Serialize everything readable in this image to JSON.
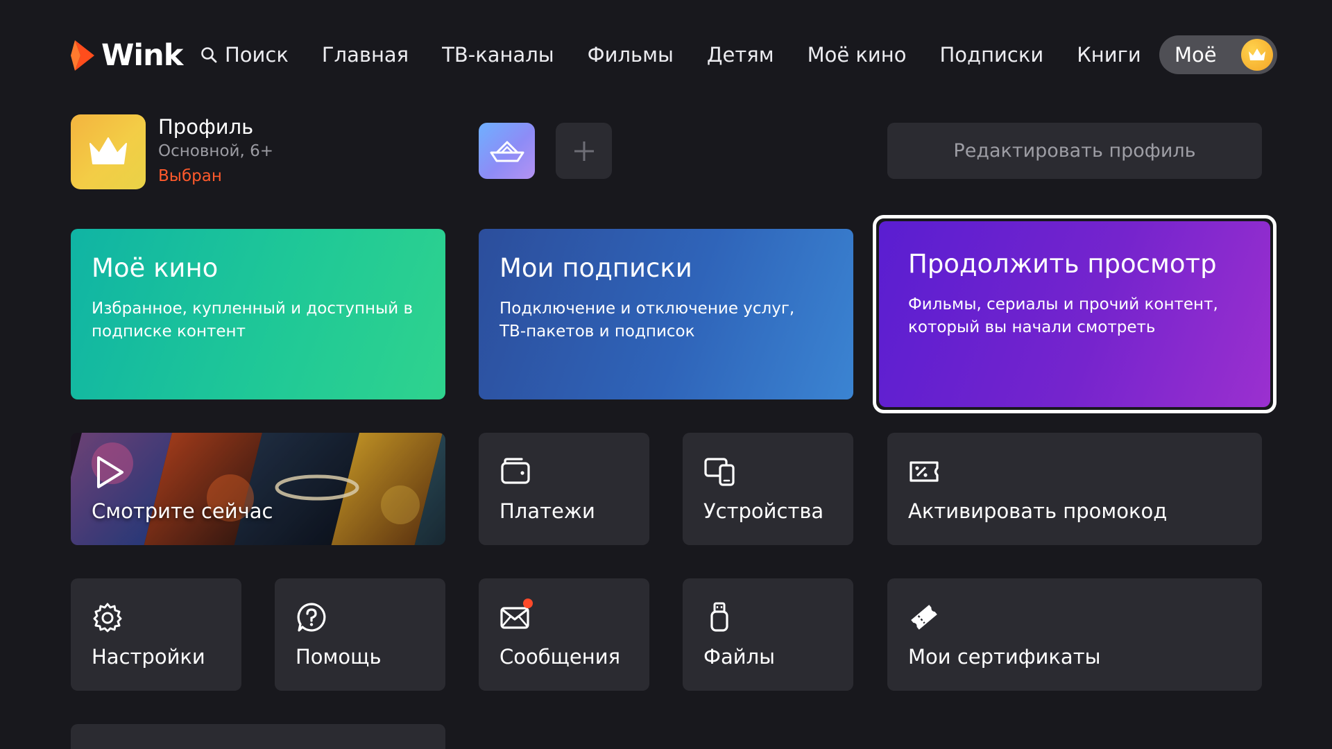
{
  "app": {
    "brand": "Wink",
    "accent_color": "#ff4d1c"
  },
  "nav": {
    "search": "Поиск",
    "items": [
      "Главная",
      "ТВ-каналы",
      "Фильмы",
      "Детям",
      "Моё кино",
      "Подписки",
      "Книги"
    ],
    "my": "Моё",
    "my_icon": "crown-icon"
  },
  "profile": {
    "name": "Профиль",
    "subtitle": "Основной, 6+",
    "status": "Выбран",
    "status_color": "#ff5a2c",
    "avatar_icon": "crown-icon",
    "alt_avatar_icon": "boat-icon",
    "add_icon": "plus-icon",
    "edit_label": "Редактировать профиль"
  },
  "features": [
    {
      "title": "Моё кино",
      "description": "Избранное, купленный и доступный в подписке контент"
    },
    {
      "title": "Мои подписки",
      "description": "Подключение и отключение услуг, ТВ-пакетов и подписок"
    },
    {
      "title": "Продолжить просмотр",
      "description": "Фильмы, сериалы и прочий контент, который вы начали смотреть"
    }
  ],
  "tiles": {
    "watch_now": {
      "label": "Смотрите сейчас",
      "icon": "play-icon"
    },
    "payments": {
      "label": "Платежи",
      "icon": "wallet-icon"
    },
    "devices": {
      "label": "Устройства",
      "icon": "devices-icon"
    },
    "promo": {
      "label": "Активировать промокод",
      "icon": "promo-ticket-icon"
    },
    "settings": {
      "label": "Настройки",
      "icon": "gear-icon"
    },
    "help": {
      "label": "Помощь",
      "icon": "help-icon"
    },
    "messages": {
      "label": "Сообщения",
      "icon": "mail-icon",
      "has_unread": true
    },
    "files": {
      "label": "Файлы",
      "icon": "usb-icon"
    },
    "certificates": {
      "label": "Мои сертификаты",
      "icon": "certificate-icon"
    }
  }
}
